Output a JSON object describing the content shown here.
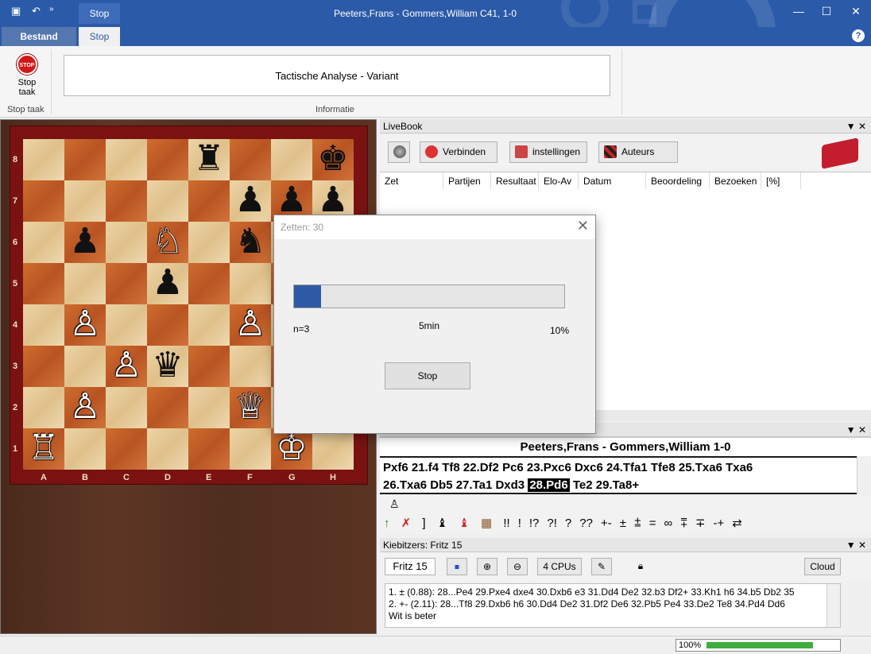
{
  "window": {
    "title": "Peeters,Frans - Gommers,William  C41, 1-0",
    "context_tab": "Stop",
    "minimize": "—",
    "maximize": "☐",
    "close": "✕",
    "help": "?"
  },
  "ribbon": {
    "tabs": {
      "file": "Bestand",
      "active": "Stop"
    },
    "stop_button": {
      "icon_text": "STOP",
      "label_line1": "Stop",
      "label_line2": "taak"
    },
    "group_stop": "Stop taak",
    "info_text": "Tactische Analyse - Variant",
    "group_info": "Informatie"
  },
  "board": {
    "files": [
      "A",
      "B",
      "C",
      "D",
      "E",
      "F",
      "G",
      "H"
    ],
    "ranks": [
      "8",
      "7",
      "6",
      "5",
      "4",
      "3",
      "2",
      "1"
    ],
    "pieces": [
      {
        "sq": "e8",
        "glyph": "♜",
        "color": "b"
      },
      {
        "sq": "h8",
        "glyph": "♚",
        "color": "b"
      },
      {
        "sq": "f7",
        "glyph": "♟",
        "color": "b"
      },
      {
        "sq": "g7",
        "glyph": "♟",
        "color": "b"
      },
      {
        "sq": "h7",
        "glyph": "♟",
        "color": "b"
      },
      {
        "sq": "b6",
        "glyph": "♟",
        "color": "b"
      },
      {
        "sq": "d6",
        "glyph": "♘",
        "color": "w"
      },
      {
        "sq": "f6",
        "glyph": "♞",
        "color": "b"
      },
      {
        "sq": "d5",
        "glyph": "♟",
        "color": "b"
      },
      {
        "sq": "b4",
        "glyph": "♙",
        "color": "w"
      },
      {
        "sq": "f4",
        "glyph": "♙",
        "color": "w"
      },
      {
        "sq": "c3",
        "glyph": "♙",
        "color": "w"
      },
      {
        "sq": "d3",
        "glyph": "♛",
        "color": "b"
      },
      {
        "sq": "b2",
        "glyph": "♙",
        "color": "w"
      },
      {
        "sq": "f2",
        "glyph": "♕",
        "color": "w"
      },
      {
        "sq": "a1",
        "glyph": "♖",
        "color": "w"
      },
      {
        "sq": "g1",
        "glyph": "♔",
        "color": "w"
      }
    ]
  },
  "livebook": {
    "title": "LiveBook",
    "buttons": {
      "connect": "Verbinden",
      "settings": "instellingen",
      "authors": "Auteurs"
    },
    "columns": [
      "Zet",
      "Partijen",
      "Resultaat",
      "Elo-Av",
      "Datum",
      "Beoordeling",
      "Bezoeken",
      "[%]"
    ]
  },
  "notation": {
    "header": "Peeters,Frans - Gommers,William  1-0",
    "line1": "Pxf6  21.f4  Tf8  22.Df2  Pc6  23.Pxc6  Dxc6  24.Tfa1  Tfe8  25.Txa6  Txa6",
    "line2_before": "26.Txa6  Db5  27.Ta1  Dxd3 ",
    "line2_current": "28.Pd6",
    "line2_after": " Te2  29.Ta8+",
    "pawn_icon": "♙",
    "symbols": [
      "!!",
      "!",
      "!?",
      "?!",
      "?",
      "??",
      "+-",
      "±",
      "⩲",
      "=",
      "∞",
      "⩱",
      "∓",
      "-+",
      "⇄"
    ]
  },
  "kibitzer": {
    "title": "Kiebitzers: Fritz 15",
    "engine": "Fritz 15",
    "cpus": "4 CPUs",
    "cloud": "Cloud",
    "lines": [
      "1. ± (0.88): 28...Pe4 29.Pxe4 dxe4 30.Dxb6 e3 31.Dd4 De2 32.b3 Df2+ 33.Kh1 h6 34.b5 Db2 35",
      "2. +- (2.11): 28...Tf8 29.Dxb6 h6 30.Dd4 De2 31.Df2 De6 32.Pb5 Pe4 33.De2 Te8 34.Pd4 Dd6",
      "Wit is beter"
    ]
  },
  "status": {
    "zoom": "100%",
    "zoom_fill": 0.8
  },
  "dialog": {
    "title": "Zetten: 30",
    "close": "✕",
    "progress_fraction": 0.1,
    "left_label": "n=3",
    "center_label": "5min",
    "right_label": "10%",
    "stop_button": "Stop"
  }
}
